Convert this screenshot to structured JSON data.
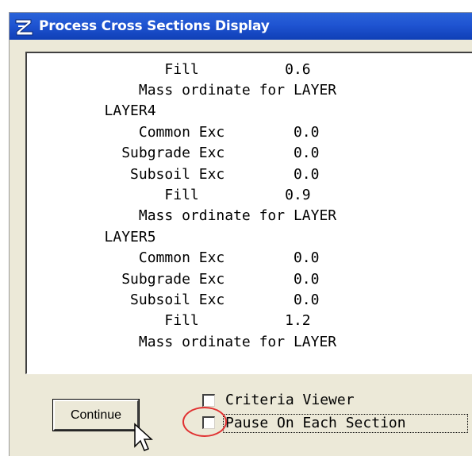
{
  "window": {
    "title": "Process Cross Sections Display"
  },
  "report": {
    "lines": [
      "                Fill          0.6",
      "             Mass ordinate for LAYER",
      "         LAYER4",
      "             Common Exc        0.0",
      "           Subgrade Exc        0.0",
      "            Subsoil Exc        0.0",
      "                Fill          0.9",
      "             Mass ordinate for LAYER",
      "         LAYER5",
      "             Common Exc        0.0",
      "           Subgrade Exc        0.0",
      "            Subsoil Exc        0.0",
      "                Fill          1.2",
      "             Mass ordinate for LAYER"
    ]
  },
  "options": {
    "criteria_viewer": {
      "label": "Criteria Viewer",
      "checked": false
    },
    "pause_each_section": {
      "label": "Pause On Each Section",
      "checked": false
    }
  },
  "buttons": {
    "continue_label": "Continue"
  },
  "colors": {
    "titlebar": "#1f54d2",
    "window_face": "#ece9d8",
    "annotation_circle": "#e03030"
  },
  "icons": {
    "app_icon": "geopak-z-icon",
    "cursor": "arrow-pointer-icon"
  }
}
